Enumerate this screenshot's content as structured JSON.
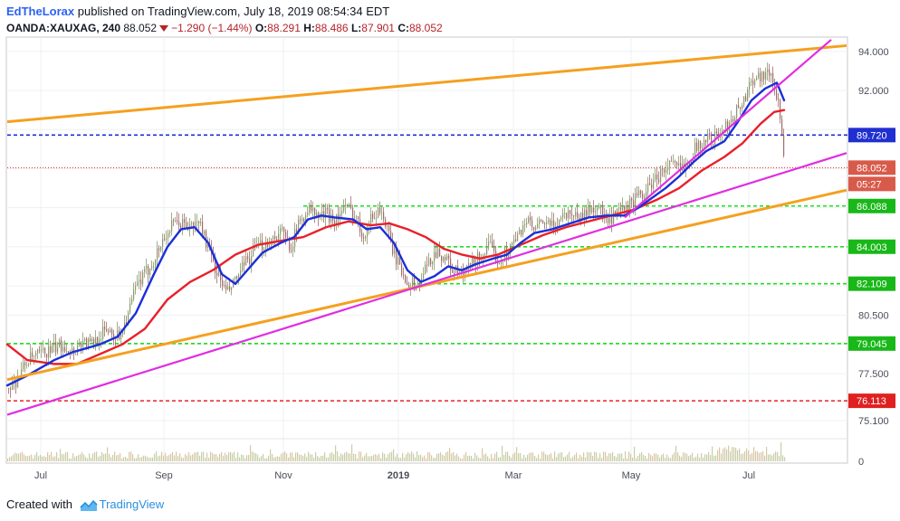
{
  "header": {
    "author": "EdTheLorax",
    "published_text": "published on TradingView.com, July 18, 2019 08:54:34 EDT",
    "symbol": "OANDA:XAUXAG, 240",
    "last": "88.052",
    "change": "−1.290 (−1.44%)",
    "open_label": "O:",
    "open": "88.291",
    "high_label": "H:",
    "high": "88.486",
    "low_label": "L:",
    "low": "87.901",
    "close_label": "C:",
    "close": "88.052"
  },
  "footer": {
    "created_with": "Created with",
    "brand": "TradingView"
  },
  "colors": {
    "blue_ma": "#1b2fd8",
    "red_ma": "#e8202a",
    "orange_trend": "#f5a020",
    "magenta_trend": "#e02ee0",
    "green_level": "#22dd22",
    "candle_up": "#8a9a6a",
    "candle_down": "#a06a6a",
    "badge_red": "#e02020",
    "badge_blue": "#1f2fd0",
    "badge_green": "#18b818",
    "badge_price": "#d85a4a"
  },
  "chart_data": {
    "type": "candlestick",
    "symbol": "OANDA:XAUXAG",
    "interval": "240",
    "x_tick_labels": [
      "Jul",
      "Sep",
      "Nov",
      "2019",
      "Mar",
      "May",
      "Jul"
    ],
    "y_tick_labels": [
      "94.000",
      "92.000",
      "89.720",
      "88.052",
      "86.088",
      "84.003",
      "82.109",
      "80.500",
      "79.045",
      "77.500",
      "76.113",
      "75.100",
      "0"
    ],
    "ylim": [
      74.8,
      94.6
    ],
    "grid": true,
    "price_close_series": [
      [
        0,
        76.5
      ],
      [
        15,
        77.0
      ],
      [
        30,
        78.2
      ],
      [
        45,
        78.5
      ],
      [
        60,
        78.8
      ],
      [
        70,
        79.0
      ],
      [
        80,
        78.6
      ],
      [
        90,
        79.2
      ],
      [
        100,
        79.0
      ],
      [
        110,
        79.5
      ],
      [
        120,
        79.8
      ],
      [
        130,
        79.4
      ],
      [
        140,
        80.4
      ],
      [
        150,
        82.0
      ],
      [
        160,
        82.6
      ],
      [
        170,
        83.4
      ],
      [
        180,
        84.4
      ],
      [
        190,
        85.1
      ],
      [
        200,
        85.2
      ],
      [
        210,
        85.0
      ],
      [
        220,
        85.3
      ],
      [
        230,
        83.8
      ],
      [
        240,
        82.6
      ],
      [
        250,
        81.6
      ],
      [
        260,
        82.3
      ],
      [
        270,
        83.1
      ],
      [
        280,
        83.8
      ],
      [
        290,
        84.1
      ],
      [
        300,
        84.4
      ],
      [
        310,
        84.8
      ],
      [
        320,
        84.0
      ],
      [
        330,
        85.2
      ],
      [
        340,
        86.0
      ],
      [
        350,
        85.5
      ],
      [
        360,
        85.7
      ],
      [
        370,
        85.4
      ],
      [
        380,
        86.0
      ],
      [
        390,
        85.8
      ],
      [
        400,
        84.6
      ],
      [
        410,
        85.5
      ],
      [
        420,
        86.0
      ],
      [
        430,
        84.3
      ],
      [
        440,
        83.0
      ],
      [
        450,
        82.2
      ],
      [
        460,
        82.0
      ],
      [
        470,
        82.9
      ],
      [
        480,
        83.8
      ],
      [
        490,
        83.5
      ],
      [
        500,
        82.8
      ],
      [
        510,
        82.5
      ],
      [
        520,
        83.1
      ],
      [
        530,
        83.5
      ],
      [
        540,
        84.0
      ],
      [
        550,
        83.3
      ],
      [
        560,
        83.8
      ],
      [
        570,
        84.4
      ],
      [
        580,
        85.4
      ],
      [
        590,
        84.8
      ],
      [
        600,
        85.3
      ],
      [
        610,
        85.0
      ],
      [
        620,
        85.6
      ],
      [
        630,
        85.8
      ],
      [
        640,
        85.5
      ],
      [
        650,
        85.9
      ],
      [
        660,
        86.1
      ],
      [
        670,
        85.2
      ],
      [
        680,
        85.6
      ],
      [
        690,
        85.9
      ],
      [
        700,
        86.4
      ],
      [
        710,
        86.7
      ],
      [
        720,
        87.3
      ],
      [
        730,
        87.8
      ],
      [
        740,
        88.2
      ],
      [
        750,
        88.0
      ],
      [
        760,
        88.5
      ],
      [
        770,
        89.2
      ],
      [
        780,
        89.5
      ],
      [
        790,
        89.6
      ],
      [
        800,
        90.0
      ],
      [
        810,
        90.8
      ],
      [
        820,
        91.4
      ],
      [
        830,
        92.6
      ],
      [
        840,
        92.8
      ],
      [
        850,
        92.9
      ],
      [
        860,
        91.3
      ],
      [
        866,
        88.1
      ]
    ],
    "blue_ma_series": [
      [
        8,
        76.9
      ],
      [
        30,
        77.4
      ],
      [
        60,
        78.2
      ],
      [
        80,
        78.6
      ],
      [
        110,
        79.0
      ],
      [
        130,
        79.4
      ],
      [
        150,
        80.6
      ],
      [
        170,
        82.6
      ],
      [
        185,
        84.0
      ],
      [
        200,
        84.9
      ],
      [
        215,
        85.0
      ],
      [
        230,
        84.2
      ],
      [
        245,
        82.6
      ],
      [
        260,
        82.1
      ],
      [
        275,
        82.9
      ],
      [
        290,
        83.7
      ],
      [
        310,
        84.2
      ],
      [
        325,
        84.5
      ],
      [
        340,
        85.4
      ],
      [
        355,
        85.6
      ],
      [
        370,
        85.5
      ],
      [
        390,
        85.4
      ],
      [
        405,
        84.9
      ],
      [
        420,
        85.0
      ],
      [
        435,
        84.2
      ],
      [
        450,
        82.8
      ],
      [
        465,
        82.2
      ],
      [
        480,
        82.5
      ],
      [
        495,
        83.0
      ],
      [
        510,
        82.8
      ],
      [
        525,
        83.1
      ],
      [
        545,
        83.4
      ],
      [
        560,
        83.6
      ],
      [
        575,
        84.2
      ],
      [
        590,
        84.7
      ],
      [
        610,
        84.9
      ],
      [
        630,
        85.2
      ],
      [
        650,
        85.5
      ],
      [
        670,
        85.6
      ],
      [
        690,
        85.6
      ],
      [
        705,
        86.0
      ],
      [
        720,
        86.5
      ],
      [
        735,
        87.0
      ],
      [
        750,
        87.6
      ],
      [
        765,
        88.3
      ],
      [
        780,
        88.9
      ],
      [
        800,
        89.4
      ],
      [
        815,
        90.4
      ],
      [
        830,
        91.5
      ],
      [
        845,
        92.1
      ],
      [
        858,
        92.4
      ],
      [
        866,
        91.5
      ]
    ],
    "red_ma_series": [
      [
        8,
        79.0
      ],
      [
        30,
        78.2
      ],
      [
        60,
        78.0
      ],
      [
        85,
        78.0
      ],
      [
        110,
        78.5
      ],
      [
        135,
        79.0
      ],
      [
        160,
        79.8
      ],
      [
        185,
        81.3
      ],
      [
        210,
        82.2
      ],
      [
        235,
        82.8
      ],
      [
        260,
        83.6
      ],
      [
        285,
        84.1
      ],
      [
        310,
        84.3
      ],
      [
        335,
        84.5
      ],
      [
        360,
        85.0
      ],
      [
        385,
        85.3
      ],
      [
        410,
        85.1
      ],
      [
        430,
        85.2
      ],
      [
        450,
        84.9
      ],
      [
        470,
        84.5
      ],
      [
        490,
        83.9
      ],
      [
        510,
        83.6
      ],
      [
        530,
        83.4
      ],
      [
        550,
        83.6
      ],
      [
        575,
        84.1
      ],
      [
        600,
        84.6
      ],
      [
        625,
        85.0
      ],
      [
        650,
        85.3
      ],
      [
        675,
        85.6
      ],
      [
        700,
        85.9
      ],
      [
        725,
        86.4
      ],
      [
        750,
        87.0
      ],
      [
        775,
        87.9
      ],
      [
        800,
        88.6
      ],
      [
        820,
        89.3
      ],
      [
        840,
        90.3
      ],
      [
        855,
        90.9
      ],
      [
        866,
        91.0
      ]
    ],
    "trendlines": [
      {
        "color": "orange",
        "from": [
          8,
          90.4
        ],
        "to": [
          935,
          94.3
        ]
      },
      {
        "color": "orange",
        "from": [
          8,
          77.2
        ],
        "to": [
          935,
          86.9
        ]
      },
      {
        "color": "magenta",
        "from": [
          8,
          75.4
        ],
        "to": [
          935,
          88.8
        ]
      },
      {
        "color": "magenta",
        "from": [
          690,
          85.5
        ],
        "to": [
          918,
          94.6
        ]
      }
    ],
    "horizontal_levels": [
      {
        "value": 89.72,
        "color": "blue",
        "style": "dashed",
        "from": 8
      },
      {
        "value": 88.052,
        "color": "red",
        "style": "dotted",
        "from": 8
      },
      {
        "value": 86.088,
        "color": "green",
        "style": "dashed",
        "from": 335
      },
      {
        "value": 84.003,
        "color": "green",
        "style": "dashed",
        "from": 480
      },
      {
        "value": 82.109,
        "color": "green",
        "style": "dashed",
        "from": 455
      },
      {
        "value": 79.045,
        "color": "green",
        "style": "dashed",
        "from": 8
      },
      {
        "value": 76.113,
        "color": "red",
        "style": "dashed",
        "from": 8
      }
    ],
    "price_badges": [
      {
        "text": "89.720",
        "value": 89.72,
        "color": "blue"
      },
      {
        "text": "88.052",
        "value": 88.052,
        "color": "price"
      },
      {
        "text": "05:27",
        "value": 88.052,
        "color": "price",
        "below": true
      },
      {
        "text": "86.088",
        "value": 86.088,
        "color": "green"
      },
      {
        "text": "84.003",
        "value": 84.003,
        "color": "green"
      },
      {
        "text": "82.109",
        "value": 82.109,
        "color": "green"
      },
      {
        "text": "79.045",
        "value": 79.045,
        "color": "green"
      },
      {
        "text": "76.113",
        "value": 76.113,
        "color": "red"
      }
    ],
    "axis_labels": [
      {
        "text": "94.000",
        "value": 94.0
      },
      {
        "text": "92.000",
        "value": 92.0
      },
      {
        "text": "80.500",
        "value": 80.5
      },
      {
        "text": "77.500",
        "value": 77.5
      },
      {
        "text": "75.100",
        "value": 75.1
      }
    ],
    "volume_zero_label": "0",
    "x_ticks": [
      {
        "text": "Jul",
        "x": 45,
        "bold": false
      },
      {
        "text": "Sep",
        "x": 181,
        "bold": false
      },
      {
        "text": "Nov",
        "x": 313,
        "bold": false
      },
      {
        "text": "2019",
        "x": 440,
        "bold": true
      },
      {
        "text": "Mar",
        "x": 567,
        "bold": false
      },
      {
        "text": "May",
        "x": 697,
        "bold": false
      },
      {
        "text": "Jul",
        "x": 827,
        "bold": false
      }
    ]
  }
}
